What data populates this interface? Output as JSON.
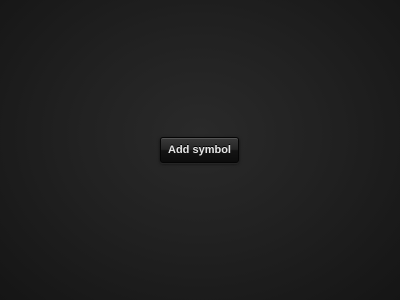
{
  "main": {
    "add_button_label": "Add symbol"
  },
  "colors": {
    "background": "#212121",
    "button_top": "#3a3a3a",
    "button_bottom": "#0c0c0c",
    "button_text": "#e4e4e4"
  }
}
